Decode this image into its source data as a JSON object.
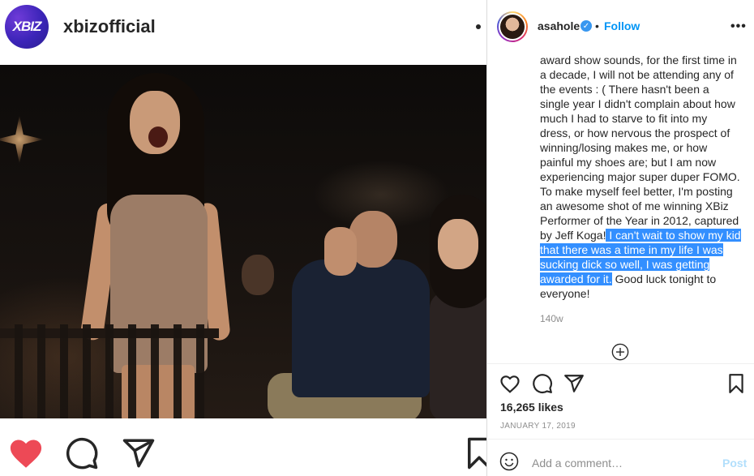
{
  "feed_post": {
    "logo_text": "XBIZ",
    "username": "xbizofficial"
  },
  "post_detail": {
    "username": "asahole",
    "follow_label": "Follow",
    "dot_separator": "•",
    "more_icon": "more-dots-icon",
    "caption": {
      "before_highlight": "award show sounds, for the first time in a decade, I will not be attending any of the events : ( There hasn't been a single year I didn't complain about how much I had to starve to fit into my dress, or how nervous the prospect of winning/losing makes me, or how painful my shoes are; but I am now experiencing major super duper FOMO. To make myself feel better, I'm posting an awesome shot of me winning XBiz Performer of the Year in 2012, captured by Jeff Koga!",
      "highlighted": " I can't wait to show my kid that there was a time in my life I was sucking dick so well, I was getting awarded for it.",
      "after_highlight": " Good luck tonight to everyone!"
    },
    "time_ago": "140w",
    "likes": "16,265 likes",
    "date": "JANUARY 17, 2019",
    "comment_placeholder": "Add a comment…",
    "post_label": "Post"
  },
  "colors": {
    "link_blue": "#0095f6",
    "highlight": "#338fff",
    "heart_red": "#ed4956",
    "verified": "#3897f0"
  }
}
